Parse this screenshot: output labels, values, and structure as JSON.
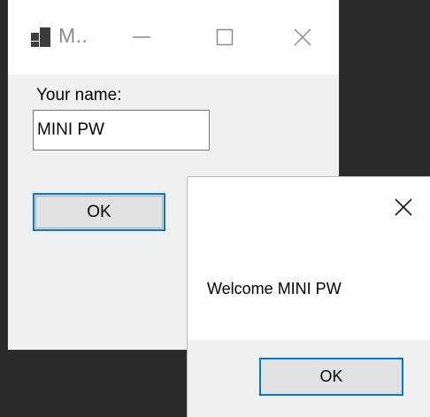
{
  "main_window": {
    "title": "M..",
    "icon": "winforms-app-icon",
    "caption_buttons": {
      "minimize_icon": "minimize-icon",
      "maximize_icon": "maximize-icon",
      "close_icon": "close-icon"
    },
    "name_label": "Your name:",
    "name_input_value": "MINI PW",
    "ok_button_label": "OK"
  },
  "message_box": {
    "close_icon": "close-icon",
    "message": "Welcome MINI PW",
    "ok_button_label": "OK"
  },
  "colors": {
    "desktop_background": "#2b2b2b",
    "window_background": "#f0f0f0",
    "titlebar_background": "#ffffff",
    "focus_accent": "#0078d7",
    "button_face": "#e1e1e1"
  }
}
